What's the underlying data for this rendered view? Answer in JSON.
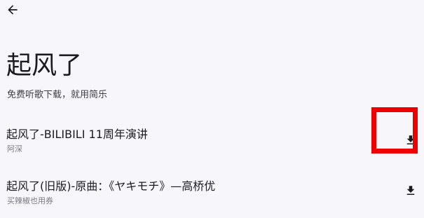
{
  "header": {
    "back_icon": "arrow-left-icon"
  },
  "page": {
    "title": "起风了",
    "subtitle": "免费听歌下载，就用简乐"
  },
  "songs": [
    {
      "title": "起风了-BILIBILI 11周年演讲",
      "artist": "阿深",
      "action_icon": "download-icon"
    },
    {
      "title": "起风了(旧版)-原曲：《ヤキモチ》—高桥优",
      "artist": "买辣椒也用券",
      "action_icon": "download-icon"
    }
  ],
  "colors": {
    "background": "#f7f6fa",
    "text": "#1b1b1f",
    "highlight": "#ee0000"
  }
}
